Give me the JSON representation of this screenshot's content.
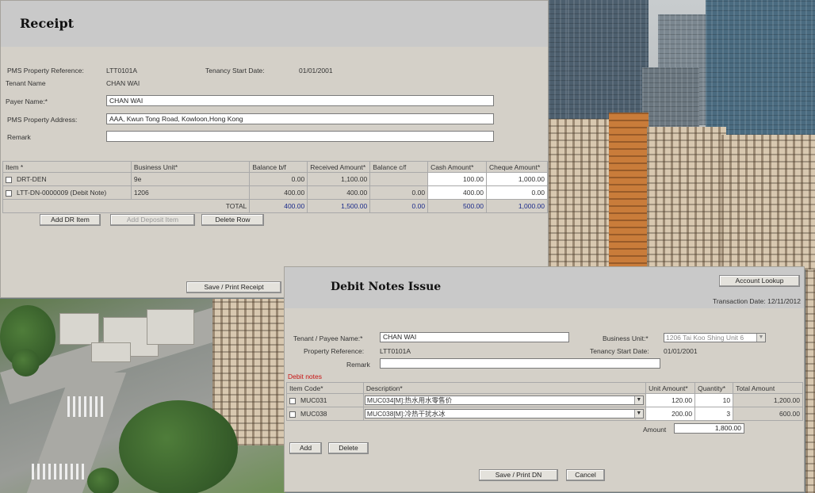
{
  "receipt": {
    "title": "Receipt",
    "pms_ref_label": "PMS Property Reference:",
    "pms_ref_value": "LTT0101A",
    "tenancy_start_label": "Tenancy Start Date:",
    "tenancy_start_value": "01/01/2001",
    "tenant_name_label": "Tenant Name",
    "tenant_name_value": "CHAN WAI",
    "payer_label": "Payer Name:*",
    "payer_value": "CHAN WAI",
    "address_label": "PMS Property Address:",
    "address_value": "AAA, Kwun Tong Road, Kowloon,Hong Kong",
    "remark_label": "Remark",
    "remark_value": "",
    "columns": [
      "Item *",
      "Business Unit*",
      "Balance b/f",
      "Received Amount*",
      "Balance c/f",
      "Cash Amount*",
      "Cheque Amount*"
    ],
    "rows": [
      {
        "item": "DRT-DEN",
        "bu": "9e",
        "bal_bf": "0.00",
        "received": "1,100.00",
        "bal_cf": "",
        "cash": "100.00",
        "cheque": "1,000.00"
      },
      {
        "item": "LTT-DN-0000009 (Debit Note)",
        "bu": "1206",
        "bal_bf": "400.00",
        "received": "400.00",
        "bal_cf": "0.00",
        "cash": "400.00",
        "cheque": "0.00"
      }
    ],
    "total": {
      "label": "TOTAL",
      "bal_bf": "400.00",
      "received": "1,500.00",
      "bal_cf": "0.00",
      "cash": "500.00",
      "cheque": "1,000.00"
    },
    "buttons": {
      "add_dr": "Add DR Item",
      "add_deposit": "Add Deposit Item",
      "delete_row": "Delete Row",
      "save_print": "Save / Print Receipt"
    }
  },
  "debit": {
    "title": "Debit Notes Issue",
    "account_lookup": "Account Lookup",
    "transaction_date": "Transaction Date: 12/11/2012",
    "tenant_label": "Tenant / Payee Name:*",
    "tenant_value": "CHAN WAI",
    "bu_label": "Business Unit:*",
    "bu_value": "1206 Tai Koo Shing Unit 6",
    "prop_ref_label": "Property Reference:",
    "prop_ref_value": "LTT0101A",
    "tenancy_start_label": "Tenancy Start Date:",
    "tenancy_start_value": "01/01/2001",
    "remark_label": "Remark",
    "remark_value": "",
    "section_label": "Debit notes",
    "columns": [
      "Item Code*",
      "Description*",
      "Unit Amount*",
      "Quantity*",
      "Total Amount"
    ],
    "rows": [
      {
        "code": "MUC031",
        "desc": "MUC034[M]:热水用水零售价",
        "unit": "120.00",
        "qty": "10",
        "total": "1,200.00"
      },
      {
        "code": "MUC038",
        "desc": "MUC038[M]:冷热干扰水冰",
        "unit": "200.00",
        "qty": "3",
        "total": "600.00"
      }
    ],
    "amount_label": "Amount",
    "amount_value": "1,800.00",
    "buttons": {
      "add": "Add",
      "delete": "Delete",
      "save_print": "Save / Print DN",
      "cancel": "Cancel"
    }
  }
}
